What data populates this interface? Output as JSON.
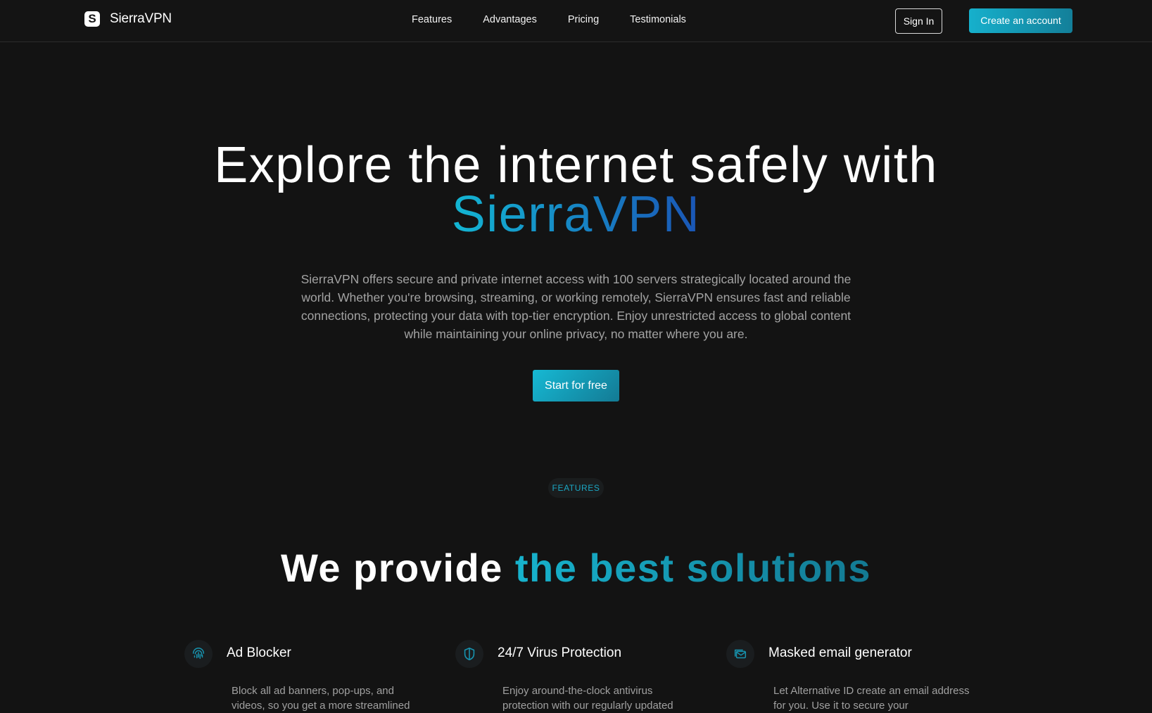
{
  "brand": {
    "name": "SierraVPN",
    "logo_letter": "S"
  },
  "nav": {
    "links": [
      {
        "label": "Features"
      },
      {
        "label": "Advantages"
      },
      {
        "label": "Pricing"
      },
      {
        "label": "Testimonials"
      }
    ],
    "signin_label": "Sign In",
    "create_label": "Create an account"
  },
  "hero": {
    "title_line1": "Explore the internet safely with",
    "title_accent": "SierraVPN",
    "description": "SierraVPN offers secure and private internet access with 100 servers strategically located around the world. Whether you're browsing, streaming, or working remotely, SierraVPN ensures fast and reliable connections, protecting your data with top-tier encryption. Enjoy unrestricted access to global content while maintaining your online privacy, no matter where you are.",
    "cta_label": "Start for free"
  },
  "features": {
    "badge": "FEATURES",
    "title_plain": "We provide ",
    "title_accent": "the best solutions",
    "items": [
      {
        "icon": "fingerprint-icon",
        "title": "Ad Blocker",
        "description": "Block all ad banners, pop-ups, and videos, so you get a more streamlined"
      },
      {
        "icon": "shield-icon",
        "title": "24/7 Virus Protection",
        "description": "Enjoy around-the-clock antivirus protection with our regularly updated"
      },
      {
        "icon": "mail-icon",
        "title": "Masked email generator",
        "description": "Let Alternative ID create an email address for you. Use it to secure your"
      }
    ]
  },
  "colors": {
    "background": "#131313",
    "accent_start": "#16b0cc",
    "accent_end": "#137f99",
    "accent_blue": "#1a55b5"
  }
}
